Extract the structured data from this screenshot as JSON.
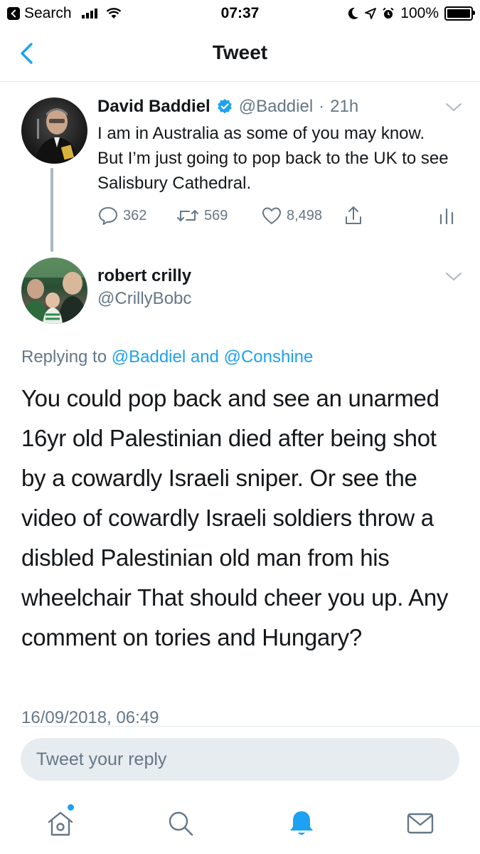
{
  "status_bar": {
    "back_app": "Search",
    "time": "07:37",
    "battery": "100%"
  },
  "nav": {
    "title": "Tweet"
  },
  "original_tweet": {
    "author_name": "David Baddiel",
    "handle": "@Baddiel",
    "separator": "·",
    "age": "21h",
    "text": "I am in Australia as some of you may know. But I’m just going to pop back to the UK to see Salisbury Cathedral.",
    "replies": "362",
    "retweets": "569",
    "likes": "8,498"
  },
  "reply_tweet": {
    "author_name": "robert crilly",
    "handle": "@CrillyBobc",
    "replying_prefix": "Replying to",
    "replying_user1": "@Baddiel",
    "replying_and": "and",
    "replying_user2": "@Conshine",
    "text": "You could pop back and see an unarmed 16yr old Palestinian died after being shot by a cowardly Israeli sniper. Or see the video of cowardly Israeli soldiers throw  a disbled Palestinian old man from his wheelchair That should cheer you up. Any comment on tories and Hungary?",
    "timestamp": "16/09/2018, 06:49"
  },
  "reply_box": {
    "placeholder": "Tweet your reply"
  },
  "colors": {
    "accent": "#1da1f2",
    "secondary_text": "#657786",
    "divider": "#e1e8ed"
  },
  "icons": {
    "tabs": [
      "home-icon",
      "search-icon",
      "notifications-icon",
      "messages-icon"
    ],
    "actions": [
      "reply-icon",
      "retweet-icon",
      "like-icon",
      "share-icon",
      "analytics-icon"
    ]
  }
}
